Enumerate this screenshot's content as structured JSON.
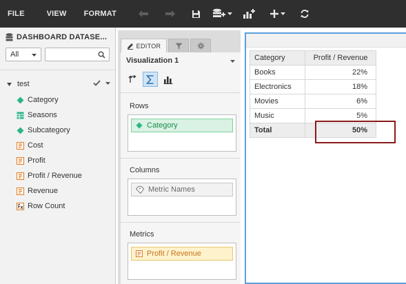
{
  "toolbar": {
    "menus": [
      "FILE",
      "VIEW",
      "FORMAT"
    ],
    "tools": [
      "undo-icon",
      "redo-icon",
      "save-icon",
      "add-data-icon",
      "insert-visualization-icon",
      "add-icon",
      "refresh-icon"
    ]
  },
  "datasets": {
    "title": "DASHBOARD DATASE...",
    "filter_value": "All",
    "search_placeholder": "",
    "dataset_name": "test",
    "fields": [
      {
        "label": "Category",
        "type": "attribute"
      },
      {
        "label": "Seasons",
        "type": "table"
      },
      {
        "label": "Subcategory",
        "type": "attribute"
      },
      {
        "label": "Cost",
        "type": "metric"
      },
      {
        "label": "Profit",
        "type": "metric"
      },
      {
        "label": "Profit / Revenue",
        "type": "metric"
      },
      {
        "label": "Revenue",
        "type": "metric"
      },
      {
        "label": "Row Count",
        "type": "derived-metric"
      }
    ]
  },
  "editor": {
    "tab_label": "EDITOR",
    "visualization_title": "Visualization 1",
    "rows_label": "Rows",
    "rows_item": "Category",
    "columns_label": "Columns",
    "columns_item": "Metric Names",
    "metrics_label": "Metrics",
    "metrics_item": "Profit / Revenue"
  },
  "grid": {
    "headers": [
      "Category",
      "Profit / Revenue"
    ],
    "rows": [
      [
        "Books",
        "22%"
      ],
      [
        "Electronics",
        "18%"
      ],
      [
        "Movies",
        "6%"
      ],
      [
        "Music",
        "5%"
      ]
    ],
    "total": [
      "Total",
      "50%"
    ]
  },
  "colors": {
    "toolbar_bg": "#2f2f2f",
    "attribute": "#2bb58a",
    "metric": "#e07b20",
    "selection_border": "#5aa0dd",
    "highlight": "#8b1a1a"
  }
}
